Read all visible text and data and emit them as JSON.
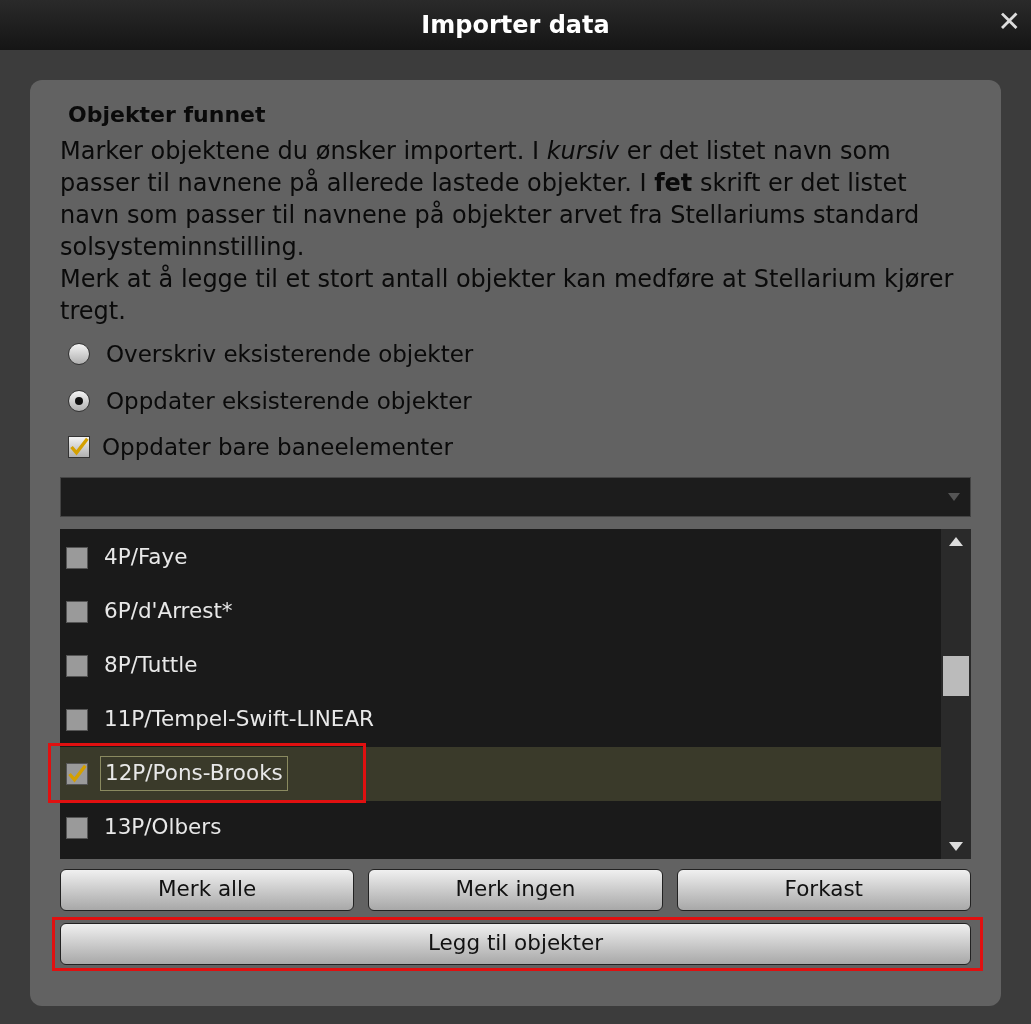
{
  "window": {
    "title": "Importer data",
    "close": "✕"
  },
  "panel": {
    "heading": "Objekter funnet",
    "description": "Marker objektene du ønsker importert. I *kursiv* er det listet navn som passer til navnene på allerede lastede objekter. I **fet** skrift er det listet navn som passer til navnene på objekter arvet fra Stellariums standard solsysteminnstilling.",
    "note": "Merk at å legge til et stort antall objekter kan medføre at Stellarium kjører tregt.",
    "radios": [
      {
        "label": "Overskriv eksisterende objekter",
        "selected": false
      },
      {
        "label": "Oppdater eksisterende objekter",
        "selected": true
      }
    ],
    "checkbox": {
      "label": "Oppdater bare baneelementer",
      "checked": true
    },
    "objects": [
      {
        "name": "4P/Faye",
        "checked": false,
        "selected": false,
        "highlighted": false
      },
      {
        "name": "6P/d'Arrest*",
        "checked": false,
        "selected": false,
        "highlighted": false
      },
      {
        "name": "8P/Tuttle",
        "checked": false,
        "selected": false,
        "highlighted": false
      },
      {
        "name": "11P/Tempel-Swift-LINEAR",
        "checked": false,
        "selected": false,
        "highlighted": false
      },
      {
        "name": "12P/Pons-Brooks",
        "checked": true,
        "selected": true,
        "highlighted": true
      },
      {
        "name": "13P/Olbers",
        "checked": false,
        "selected": false,
        "highlighted": false
      }
    ],
    "buttons": [
      {
        "label": "Merk alle"
      },
      {
        "label": "Merk ingen"
      },
      {
        "label": "Forkast"
      }
    ],
    "add_button": {
      "label": "Legg til objekter",
      "highlighted": true
    }
  }
}
